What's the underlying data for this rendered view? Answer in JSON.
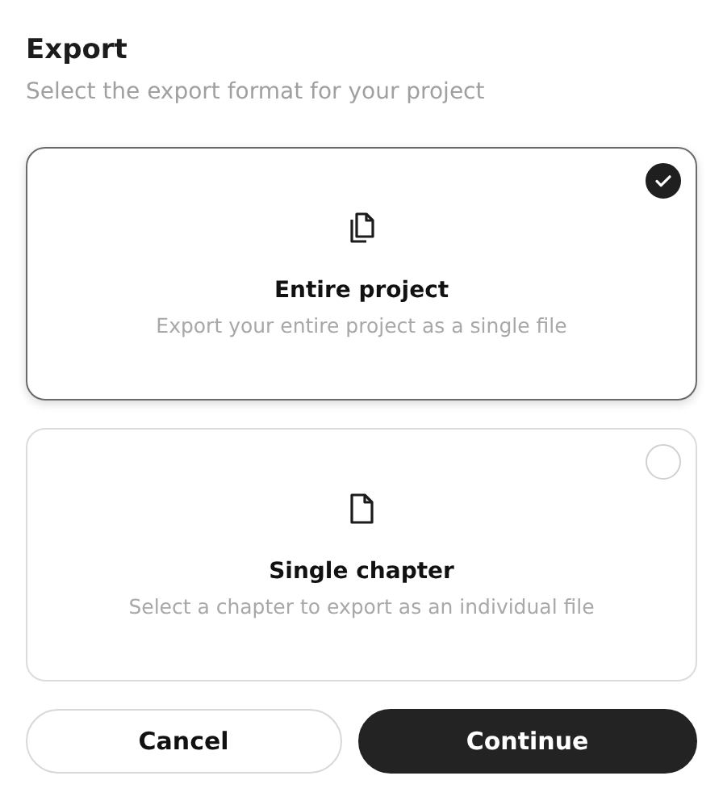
{
  "title": "Export",
  "subtitle": "Select the export format for your project",
  "options": [
    {
      "kind": "project",
      "title": "Entire project",
      "description": "Export your entire project as a single file",
      "selected": true
    },
    {
      "kind": "chapter",
      "title": "Single chapter",
      "description": "Select a chapter to export as an individual file",
      "selected": false
    }
  ],
  "buttons": [
    {
      "label": "Cancel",
      "kind": "secondary"
    },
    {
      "label": "Continue",
      "kind": "primary"
    }
  ]
}
